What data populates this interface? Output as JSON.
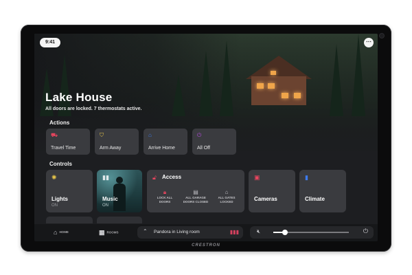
{
  "status": {
    "time": "9:41"
  },
  "header": {
    "title": "Lake House",
    "subtitle": "All doors are locked. 7 thermostats active."
  },
  "actions": {
    "heading": "Actions",
    "items": [
      {
        "label": "Travel Time",
        "icon": "car-icon",
        "color": "#e8455e"
      },
      {
        "label": "Arm Away",
        "icon": "shield-icon",
        "color": "#e8c64a"
      },
      {
        "label": "Arrive Home",
        "icon": "home-icon",
        "color": "#3d7bf0"
      },
      {
        "label": "All Off",
        "icon": "power-icon",
        "color": "#b04ad8"
      }
    ]
  },
  "controls": {
    "heading": "Controls",
    "lights": {
      "label": "Lights",
      "status": "ON",
      "icon": "bulb-icon",
      "color": "#e8c64a"
    },
    "music": {
      "label": "Music",
      "status": "ON",
      "icon": "music-bars-icon"
    },
    "access": {
      "label": "Access",
      "icon": "lock-icon",
      "color": "#e8455e",
      "items": [
        {
          "label_line1": "LOCK ALL",
          "label_line2": "DOORS",
          "icon": "lock-icon",
          "color": "#e8455e"
        },
        {
          "label_line1": "ALL GARAGE",
          "label_line2": "DOORS CLOSED",
          "icon": "garage-icon",
          "color": "#bdbdc2"
        },
        {
          "label_line1": "ALL GATES",
          "label_line2": "LOCKED",
          "icon": "gate-icon",
          "color": "#bdbdc2"
        }
      ]
    },
    "cameras": {
      "label": "Cameras",
      "icon": "camera-icon",
      "color": "#e8455e"
    },
    "climate": {
      "label": "Climate",
      "icon": "thermostat-icon",
      "color": "#3d7bf0"
    }
  },
  "bottom_nav": {
    "home_label": "HOME",
    "rooms_label": "ROOMS",
    "now_playing": "Pandora in Living room",
    "volume_level": 0.15,
    "accent_color": "#d4415e"
  },
  "device": {
    "brand": "CRESTRON"
  }
}
